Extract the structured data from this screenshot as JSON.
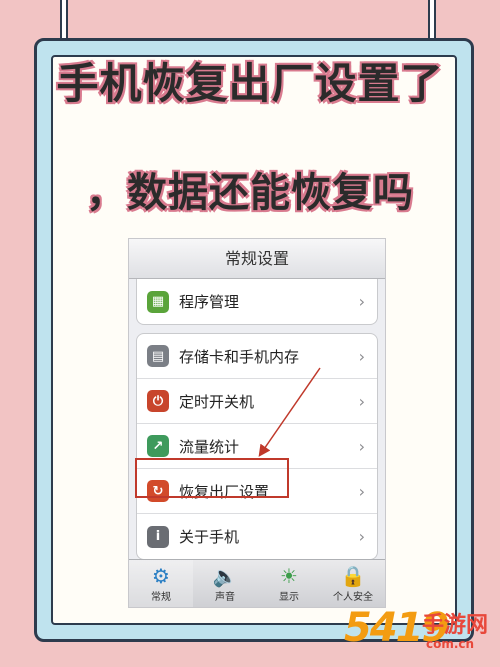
{
  "headline": {
    "line1": "手机恢复出厂设置了",
    "line2": "，数据还能恢复吗"
  },
  "phone": {
    "nav_title": "常规设置",
    "group1": [
      {
        "label": "程序管理",
        "icon": "grid-icon",
        "color": "#5aa43a"
      }
    ],
    "group2": [
      {
        "label": "存储卡和手机内存",
        "icon": "sd-card-icon",
        "color": "#7b7f86"
      },
      {
        "label": "定时开关机",
        "icon": "power-icon",
        "color": "#c8452c"
      },
      {
        "label": "流量统计",
        "icon": "chart-icon",
        "color": "#3e9a5c"
      },
      {
        "label": "恢复出厂设置",
        "icon": "restore-icon",
        "color": "#d24a2a"
      },
      {
        "label": "关于手机",
        "icon": "info-icon",
        "color": "#6a6d73"
      }
    ],
    "tabs": [
      {
        "label": "常规",
        "icon": "gears-icon"
      },
      {
        "label": "声音",
        "icon": "speaker-icon"
      },
      {
        "label": "显示",
        "icon": "brightness-icon"
      },
      {
        "label": "个人安全",
        "icon": "lock-icon"
      }
    ]
  },
  "watermark": {
    "number": "5419",
    "text": "手游网",
    "url": "com.cn"
  },
  "colors": {
    "background": "#f2c4c4",
    "card": "#bfe3ee",
    "highlight": "#c0392b"
  }
}
